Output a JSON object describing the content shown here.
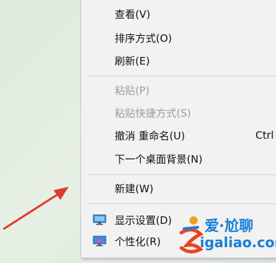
{
  "context_menu": {
    "items": [
      {
        "label": "查看(V)"
      },
      {
        "label": "排序方式(O)"
      },
      {
        "label": "刷新(E)"
      },
      {
        "label": "粘贴(P)"
      },
      {
        "label": "粘贴快捷方式(S)"
      },
      {
        "label": "撤消 重命名(U)",
        "shortcut": "Ctrl"
      },
      {
        "label": "下一个桌面背景(N)"
      },
      {
        "label": "新建(W)"
      },
      {
        "label": "显示设置(D)",
        "icon": "monitor-icon"
      },
      {
        "label": "个性化(R)",
        "icon": "personalize-icon"
      }
    ]
  },
  "watermark": {
    "line1": "爱·尬聊",
    "line2": "igaliao.com"
  },
  "colors": {
    "menu_bg": "#f2f2f2",
    "disabled_text": "#9d9d9d",
    "arrow": "#e03a2e",
    "watermark": "#1a7fd6"
  }
}
